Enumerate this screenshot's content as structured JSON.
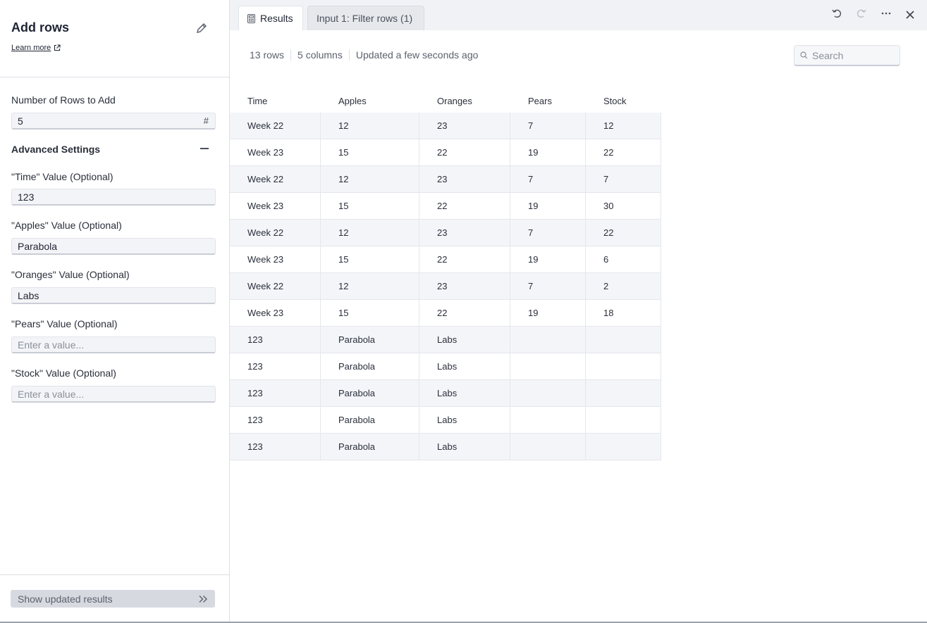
{
  "left_panel": {
    "title": "Add rows",
    "learn_more": "Learn more",
    "rows_to_add": {
      "label": "Number of Rows to Add",
      "value": "5",
      "suffix": "#"
    },
    "advanced_title": "Advanced Settings",
    "fields": [
      {
        "label": "\"Time\" Value (Optional)",
        "value": "123",
        "placeholder": "Enter a value..."
      },
      {
        "label": "\"Apples\" Value (Optional)",
        "value": "Parabola",
        "placeholder": "Enter a value..."
      },
      {
        "label": "\"Oranges\" Value (Optional)",
        "value": "Labs",
        "placeholder": "Enter a value..."
      },
      {
        "label": "\"Pears\" Value (Optional)",
        "value": "",
        "placeholder": "Enter a value..."
      },
      {
        "label": "\"Stock\" Value (Optional)",
        "value": "",
        "placeholder": "Enter a value..."
      }
    ],
    "show_button": "Show updated results"
  },
  "right_panel": {
    "tabs": [
      {
        "label": "Results",
        "active": true
      },
      {
        "label": "Input 1: Filter rows (1)",
        "active": false
      }
    ],
    "meta": {
      "rows": "13 rows",
      "columns": "5 columns",
      "updated": "Updated a few seconds ago"
    },
    "search_placeholder": "Search",
    "table": {
      "headers": [
        "Time",
        "Apples",
        "Oranges",
        "Pears",
        "Stock"
      ],
      "rows": [
        [
          "Week 22",
          "12",
          "23",
          "7",
          "12"
        ],
        [
          "Week 23",
          "15",
          "22",
          "19",
          "22"
        ],
        [
          "Week 22",
          "12",
          "23",
          "7",
          "7"
        ],
        [
          "Week 23",
          "15",
          "22",
          "19",
          "30"
        ],
        [
          "Week 22",
          "12",
          "23",
          "7",
          "22"
        ],
        [
          "Week 23",
          "15",
          "22",
          "19",
          "6"
        ],
        [
          "Week 22",
          "12",
          "23",
          "7",
          "2"
        ],
        [
          "Week 23",
          "15",
          "22",
          "19",
          "18"
        ],
        [
          "123",
          "Parabola",
          "Labs",
          "",
          ""
        ],
        [
          "123",
          "Parabola",
          "Labs",
          "",
          ""
        ],
        [
          "123",
          "Parabola",
          "Labs",
          "",
          ""
        ],
        [
          "123",
          "Parabola",
          "Labs",
          "",
          ""
        ],
        [
          "123",
          "Parabola",
          "Labs",
          "",
          ""
        ]
      ]
    }
  },
  "icons": {
    "edit": "pencil-icon",
    "external": "external-link-icon",
    "collapse": "minus-icon",
    "chevrons": "double-chevron-right-icon",
    "results_tab": "calculator-icon",
    "undo": "undo-icon",
    "redo": "redo-icon",
    "more": "more-icon",
    "close": "close-icon",
    "search": "search-icon"
  }
}
